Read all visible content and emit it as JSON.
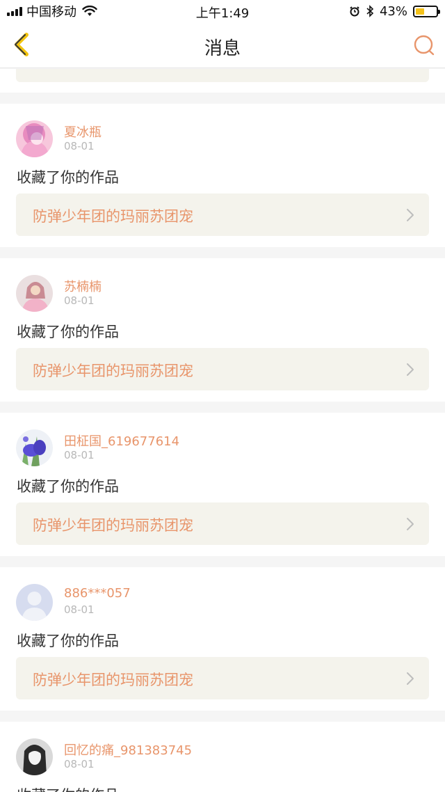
{
  "status_bar": {
    "carrier": "中国移动",
    "time": "上午1:49",
    "battery_percent": "43%",
    "battery_level": 0.43
  },
  "nav": {
    "title": "消息"
  },
  "messages": [
    {
      "username": "夏冰瓶",
      "date": "08-01",
      "action": "收藏了你的作品",
      "item_title": "防弹少年团的玛丽苏团宠",
      "avatar_colors": [
        "#f7c7dc",
        "#e88cbf",
        "#b86fb8"
      ]
    },
    {
      "username": "苏楠楠",
      "date": "08-01",
      "action": "收藏了你的作品",
      "item_title": "防弹少年团的玛丽苏团宠",
      "avatar_colors": [
        "#eadfe0",
        "#f2b2c8",
        "#c98b93"
      ]
    },
    {
      "username": "田柾国_619677614",
      "date": "08-01",
      "action": "收藏了你的作品",
      "item_title": "防弹少年团的玛丽苏团宠",
      "avatar_colors": [
        "#eef1f6",
        "#5a4fd6",
        "#7bb06a"
      ]
    },
    {
      "username": "886***057",
      "date": "08-01",
      "action": "收藏了你的作品",
      "item_title": "防弹少年团的玛丽苏团宠",
      "avatar_colors": [
        "#d6dcef",
        "#f0f2f8",
        "#c3cbe6"
      ]
    },
    {
      "username": "回忆的痛_981383745",
      "date": "08-01",
      "action": "收藏了你的作品",
      "item_title": "",
      "avatar_colors": [
        "#d9d9d9",
        "#2b2b2b",
        "#f3f3f3"
      ]
    }
  ],
  "colors": {
    "accent": "#e8956b",
    "item_bg": "#f4f3ec",
    "back_icon": "#e8b020"
  }
}
